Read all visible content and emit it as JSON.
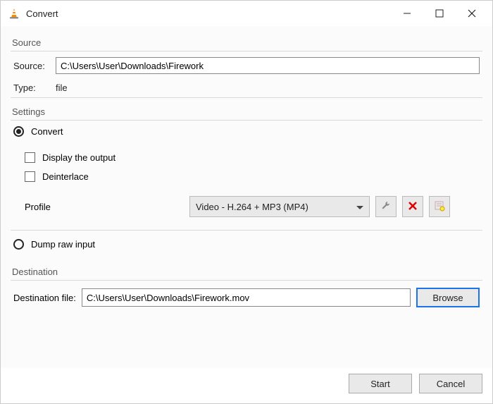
{
  "window": {
    "title": "Convert"
  },
  "source": {
    "group_label": "Source",
    "source_label": "Source:",
    "source_value": "C:\\Users\\User\\Downloads\\Firework",
    "type_label": "Type:",
    "type_value": "file"
  },
  "settings": {
    "group_label": "Settings",
    "convert_label": "Convert",
    "display_output_label": "Display the output",
    "deinterlace_label": "Deinterlace",
    "profile_label": "Profile",
    "profile_value": "Video - H.264 + MP3 (MP4)",
    "dump_raw_label": "Dump raw input"
  },
  "destination": {
    "group_label": "Destination",
    "file_label": "Destination file:",
    "file_value": "C:\\Users\\User\\Downloads\\Firework.mov",
    "browse_label": "Browse"
  },
  "footer": {
    "start_label": "Start",
    "cancel_label": "Cancel"
  }
}
